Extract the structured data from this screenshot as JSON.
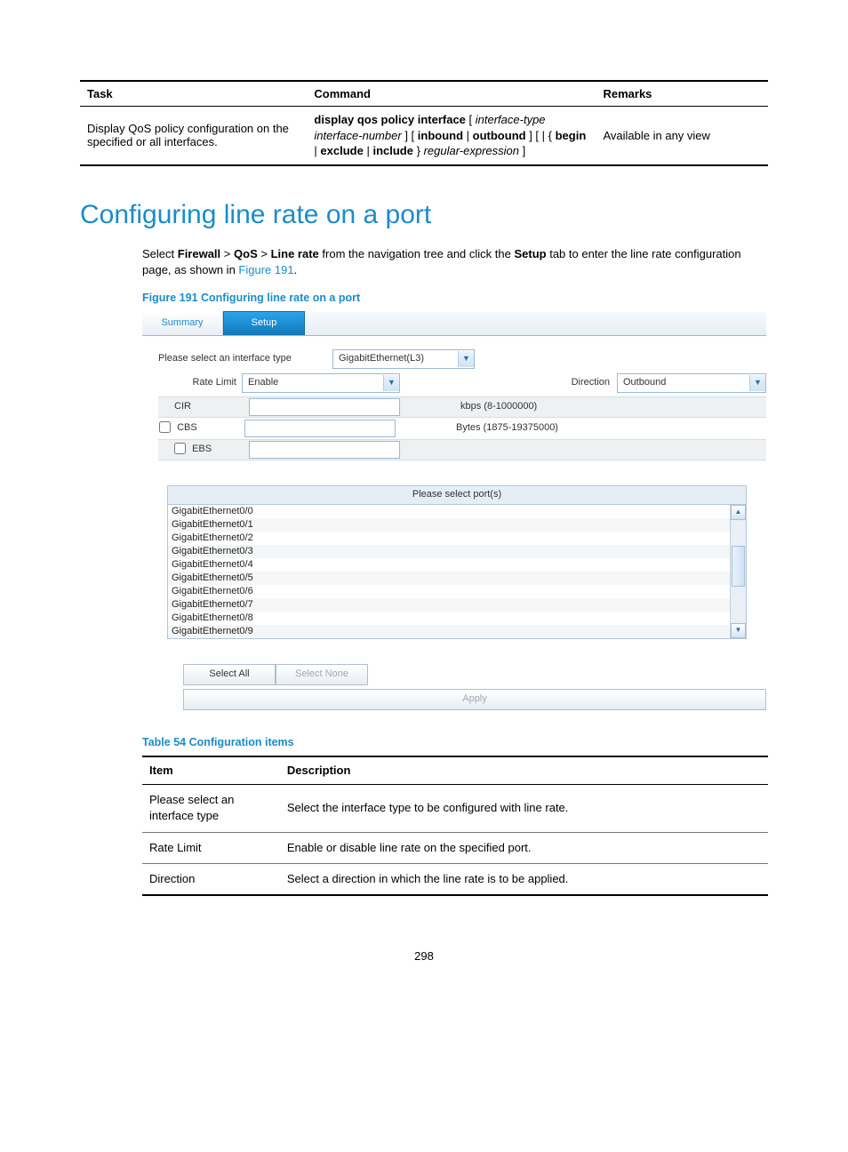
{
  "task_table": {
    "headers": {
      "task": "Task",
      "command": "Command",
      "remarks": "Remarks"
    },
    "row": {
      "task": "Display QoS policy configuration on the specified or all interfaces.",
      "command": {
        "tok1b": "display qos policy interface",
        "tok2i": "interface-type interface-number",
        "tok3b": "inbound",
        "tok4b": "outbound",
        "tok5b": "begin",
        "tok6b": "exclude",
        "tok7b": "include",
        "tok8i": "regular-expression"
      },
      "remarks": "Available in any view"
    }
  },
  "heading": "Configuring line rate on a port",
  "intro": {
    "p1a": "Select ",
    "b1": "Firewall",
    "sep": " > ",
    "b2": "QoS",
    "b3": "Line rate",
    "p1b": " from the navigation tree and click the ",
    "b4": "Setup",
    "p1c": " tab to enter the line rate configuration page, as shown in ",
    "link": "Figure 191",
    "p1d": "."
  },
  "figure_caption": "Figure 191 Configuring line rate on a port",
  "figure": {
    "tabs": {
      "summary": "Summary",
      "setup": "Setup"
    },
    "iface_label": "Please select an interface type",
    "iface_value": "GigabitEthernet(L3)",
    "rate_limit_label": "Rate Limit",
    "rate_limit_value": "Enable",
    "direction_label": "Direction",
    "direction_value": "Outbound",
    "rows": {
      "cir": {
        "label": "CIR",
        "hint": "kbps (8-1000000)"
      },
      "cbs": {
        "label": "CBS",
        "hint": "Bytes (1875-19375000)"
      },
      "ebs": {
        "label": "EBS",
        "hint": ""
      }
    },
    "port_header": "Please select port(s)",
    "ports": [
      "GigabitEthernet0/0",
      "GigabitEthernet0/1",
      "GigabitEthernet0/2",
      "GigabitEthernet0/3",
      "GigabitEthernet0/4",
      "GigabitEthernet0/5",
      "GigabitEthernet0/6",
      "GigabitEthernet0/7",
      "GigabitEthernet0/8",
      "GigabitEthernet0/9"
    ],
    "buttons": {
      "select_all": "Select All",
      "select_none": "Select None",
      "apply": "Apply"
    }
  },
  "table54_caption": "Table 54 Configuration items",
  "table54": {
    "headers": {
      "item": "Item",
      "desc": "Description"
    },
    "rows": [
      {
        "item": "Please select an interface type",
        "desc": "Select the interface type to be configured with line rate."
      },
      {
        "item": "Rate Limit",
        "desc": "Enable or disable line rate on the specified port."
      },
      {
        "item": "Direction",
        "desc": "Select a direction in which the line rate is to be applied."
      }
    ]
  },
  "page_number": "298"
}
